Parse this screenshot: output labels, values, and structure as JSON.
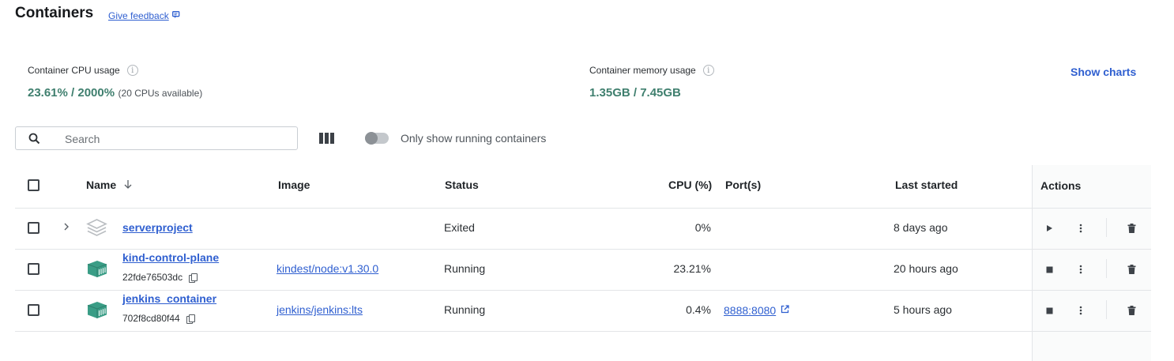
{
  "header": {
    "title": "Containers",
    "feedback_label": "Give feedback"
  },
  "stats": {
    "cpu": {
      "label": "Container CPU usage",
      "value": "23.61% / 2000%",
      "sub": "(20 CPUs available)"
    },
    "memory": {
      "label": "Container memory usage",
      "value": "1.35GB / 7.45GB"
    },
    "show_charts": "Show charts"
  },
  "toolbar": {
    "search_placeholder": "Search",
    "toggle_label": "Only show running containers",
    "toggle_on": false
  },
  "table": {
    "headers": {
      "name": "Name",
      "image": "Image",
      "status": "Status",
      "cpu": "CPU (%)",
      "ports": "Port(s)",
      "last_started": "Last started",
      "actions": "Actions"
    },
    "rows": [
      {
        "name": "serverproject",
        "id": "",
        "image": "",
        "status": "Exited",
        "cpu": "0%",
        "port": "",
        "last_started": "8 days ago",
        "kind": "stack",
        "primary_action": "start"
      },
      {
        "name": "kind-control-plane",
        "id": "22fde76503dc",
        "image": "kindest/node:v1.30.0",
        "status": "Running",
        "cpu": "23.21%",
        "port": "",
        "last_started": "20 hours ago",
        "kind": "container",
        "primary_action": "stop"
      },
      {
        "name": "jenkins_container",
        "id": "702f8cd80f44",
        "image": "jenkins/jenkins:lts",
        "status": "Running",
        "cpu": "0.4%",
        "port": "8888:8080",
        "last_started": "5 hours ago",
        "kind": "container",
        "primary_action": "stop"
      }
    ]
  },
  "colors": {
    "accent": "#2f5fd0",
    "stat_value": "#3f7f6e",
    "container_icon": "#3a9d86",
    "stack_icon": "#b9bdc1"
  }
}
